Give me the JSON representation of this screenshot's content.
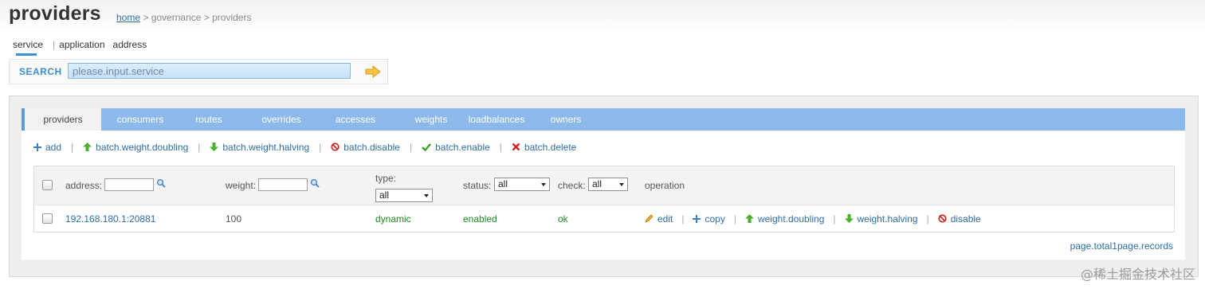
{
  "header": {
    "title": "providers",
    "breadcrumb": {
      "home": "home",
      "sep1": " > ",
      "governance": "governance",
      "sep2": " > ",
      "current": "providers"
    }
  },
  "subnav": {
    "items": [
      "service",
      "application",
      "address"
    ],
    "separator": "|"
  },
  "search": {
    "label": "SEARCH",
    "value": "please.input.service",
    "go_icon": "arrow-right-icon"
  },
  "tabs": [
    "providers",
    "consumers",
    "routes",
    "overrides",
    "accesses",
    "weights",
    "loadbalances",
    "owners"
  ],
  "actions": {
    "add": "add",
    "batch_weight_doubling": "batch.weight.doubling",
    "batch_weight_halving": "batch.weight.halving",
    "batch_disable": "batch.disable",
    "batch_enable": "batch.enable",
    "batch_delete": "batch.delete",
    "separator": "|"
  },
  "table": {
    "headers": {
      "address": "address:",
      "weight": "weight:",
      "type": "type:",
      "type_value": "all",
      "status": "status:",
      "status_value": "all",
      "check": "check:",
      "check_value": "all",
      "operation": "operation"
    },
    "rows": [
      {
        "address": "192.168.180.1:20881",
        "weight": "100",
        "type": "dynamic",
        "status": "enabled",
        "check": "ok",
        "ops": {
          "edit": "edit",
          "copy": "copy",
          "weight_doubling": "weight.doubling",
          "weight_halving": "weight.halving",
          "disable": "disable"
        }
      }
    ]
  },
  "pager": "page.total1page.records",
  "watermark": "@稀土掘金技术社区",
  "colors": {
    "accent": "#3a8fd8",
    "tab_bar": "#8cb9e9",
    "link": "#2e6da4",
    "ok_green": "#1e8a1e",
    "danger": "#cc2222"
  }
}
